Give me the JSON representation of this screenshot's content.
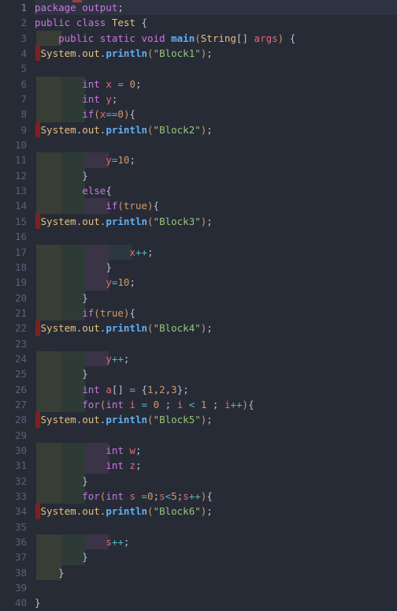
{
  "editor": {
    "name": "java-code-editor",
    "language": "Java",
    "total_lines": 40,
    "current_line": 1,
    "colors": {
      "background": "#272b36",
      "current_line_bg": "#2e3342",
      "gutter_text": "#57617a",
      "keyword": "#c678dd",
      "type": "#e5c07b",
      "function": "#61afef",
      "identifier": "#e06c75",
      "number": "#d19a66",
      "string": "#98c379",
      "operator": "#56b6c2",
      "punctuation": "#b7bfd1",
      "error_stripe": "#7c2020",
      "indent_guide_1": "#383e35",
      "indent_guide_2": "#2e3a36",
      "indent_guide_3": "#3a3446",
      "indent_guide_4": "#2b3741"
    }
  },
  "lines": [
    {
      "n": 1,
      "text": "package output;"
    },
    {
      "n": 2,
      "text": "public class Test {"
    },
    {
      "n": 3,
      "text": "    public static void main(String[] args) {"
    },
    {
      "n": 4,
      "text": "System.out.println(\"Block1\");"
    },
    {
      "n": 5,
      "text": ""
    },
    {
      "n": 6,
      "text": "        int x = 0;"
    },
    {
      "n": 7,
      "text": "        int y;"
    },
    {
      "n": 8,
      "text": "        if(x==0){"
    },
    {
      "n": 9,
      "text": "System.out.println(\"Block2\");"
    },
    {
      "n": 10,
      "text": ""
    },
    {
      "n": 11,
      "text": "            y=10;"
    },
    {
      "n": 12,
      "text": "        }"
    },
    {
      "n": 13,
      "text": "        else{"
    },
    {
      "n": 14,
      "text": "            if(true){"
    },
    {
      "n": 15,
      "text": "System.out.println(\"Block3\");"
    },
    {
      "n": 16,
      "text": ""
    },
    {
      "n": 17,
      "text": "                x++;"
    },
    {
      "n": 18,
      "text": "            }"
    },
    {
      "n": 19,
      "text": "            y=10;"
    },
    {
      "n": 20,
      "text": "        }"
    },
    {
      "n": 21,
      "text": "        if(true){"
    },
    {
      "n": 22,
      "text": "System.out.println(\"Block4\");"
    },
    {
      "n": 23,
      "text": ""
    },
    {
      "n": 24,
      "text": "            y++;"
    },
    {
      "n": 25,
      "text": "        }"
    },
    {
      "n": 26,
      "text": "        int a[] = {1,2,3};"
    },
    {
      "n": 27,
      "text": "        for(int i = 0 ; i < 1 ; i++){"
    },
    {
      "n": 28,
      "text": "System.out.println(\"Block5\");"
    },
    {
      "n": 29,
      "text": ""
    },
    {
      "n": 30,
      "text": "            int w;"
    },
    {
      "n": 31,
      "text": "            int z;"
    },
    {
      "n": 32,
      "text": "        }"
    },
    {
      "n": 33,
      "text": "        for(int s =0;s<5;s++){"
    },
    {
      "n": 34,
      "text": "System.out.println(\"Block6\");"
    },
    {
      "n": 35,
      "text": ""
    },
    {
      "n": 36,
      "text": "            s++;"
    },
    {
      "n": 37,
      "text": "        }"
    },
    {
      "n": 38,
      "text": "    }"
    },
    {
      "n": 39,
      "text": ""
    },
    {
      "n": 40,
      "text": "}"
    }
  ]
}
